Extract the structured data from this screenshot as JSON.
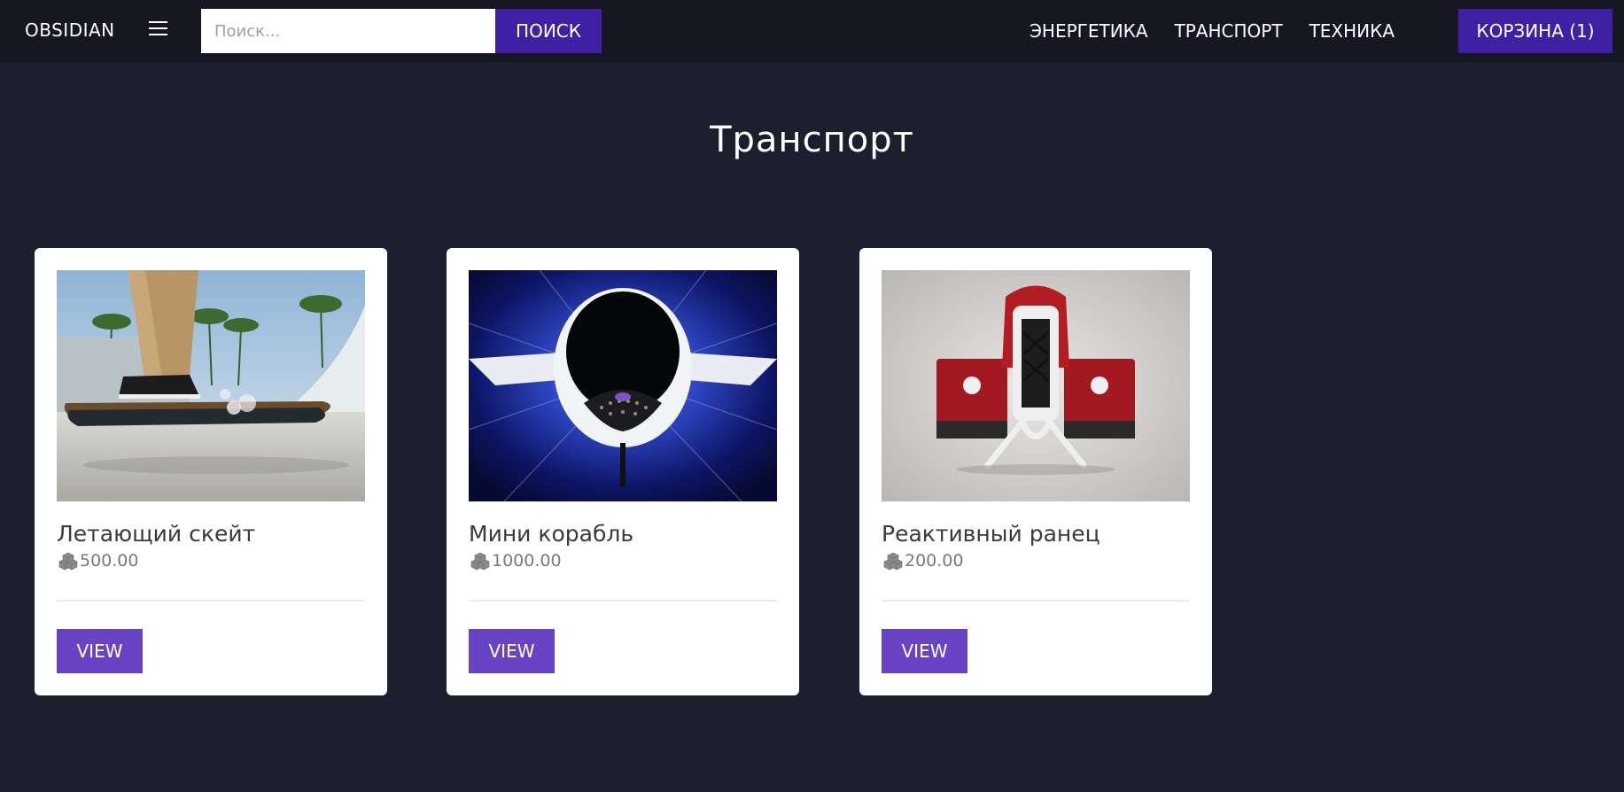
{
  "navbar": {
    "brand": "OBSIDIAN",
    "search_placeholder": "Поиск...",
    "search_button": "ПОИСК",
    "links": [
      "ЭНЕРГЕТИКА",
      "ТРАНСПОРТ",
      "ТЕХНИКА"
    ],
    "cart_label": "КОРЗИНА (1)"
  },
  "page": {
    "title": "Транспорт"
  },
  "products": [
    {
      "name": "Летающий скейт",
      "price": "500.00",
      "button": "VIEW",
      "image_icon": "hoverboard-image"
    },
    {
      "name": "Мини корабль",
      "price": "1000.00",
      "button": "VIEW",
      "image_icon": "mini-ship-image"
    },
    {
      "name": "Реактивный ранец",
      "price": "200.00",
      "button": "VIEW",
      "image_icon": "jetpack-image"
    }
  ],
  "colors": {
    "background": "#1e1f2e",
    "navbar": "#161722",
    "primary_button": "#3f1fa3",
    "view_button": "#6843c4"
  }
}
